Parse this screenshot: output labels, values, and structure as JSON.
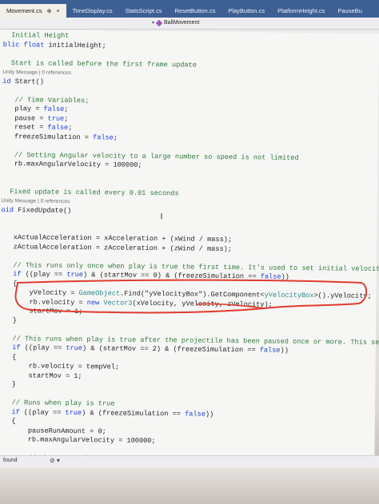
{
  "tabs": [
    {
      "label": "Movement.cs",
      "close": "×",
      "pin": "⊕",
      "active": true
    },
    {
      "label": "TimeDisplay.cs",
      "active": false
    },
    {
      "label": "StatsScript.cs",
      "active": false
    },
    {
      "label": "ResetButton.cs",
      "active": false
    },
    {
      "label": "PlayButton.cs",
      "active": false
    },
    {
      "label": "PlatformHeight.cs",
      "active": false
    },
    {
      "label": "PauseBu",
      "active": false
    }
  ],
  "nav": {
    "member": "BallMovement",
    "dropdown": "▾"
  },
  "code": [
    {
      "segments": [
        {
          "t": "  Initial Height",
          "c": "cm"
        }
      ]
    },
    {
      "segments": [
        {
          "t": "blic ",
          "c": "kw"
        },
        {
          "t": "float ",
          "c": "kw"
        },
        {
          "t": "initialHeight;"
        }
      ]
    },
    {
      "segments": [
        {
          "t": " "
        }
      ]
    },
    {
      "segments": [
        {
          "t": "  Start is called before the first frame update",
          "c": "cm"
        }
      ]
    },
    {
      "meta": "Unity Message | 0 references"
    },
    {
      "segments": [
        {
          "t": "id ",
          "c": "kw"
        },
        {
          "t": "Start()"
        }
      ]
    },
    {
      "segments": [
        {
          "t": " "
        }
      ]
    },
    {
      "segments": [
        {
          "t": "   // Time Variables;",
          "c": "cm"
        }
      ]
    },
    {
      "segments": [
        {
          "t": "   play = "
        },
        {
          "t": "false",
          "c": "kw"
        },
        {
          "t": ";"
        }
      ]
    },
    {
      "segments": [
        {
          "t": "   pause = "
        },
        {
          "t": "true",
          "c": "kw"
        },
        {
          "t": ";"
        }
      ]
    },
    {
      "segments": [
        {
          "t": "   reset = "
        },
        {
          "t": "false",
          "c": "kw"
        },
        {
          "t": ";"
        }
      ]
    },
    {
      "segments": [
        {
          "t": "   freezeSimulation = "
        },
        {
          "t": "false",
          "c": "kw"
        },
        {
          "t": ";"
        }
      ]
    },
    {
      "segments": [
        {
          "t": " "
        }
      ]
    },
    {
      "segments": [
        {
          "t": "   // Setting Angular velocity to a large number so speed is not limited",
          "c": "cm"
        }
      ]
    },
    {
      "segments": [
        {
          "t": "   rb.maxAngularVelocity = 100000;"
        }
      ]
    },
    {
      "segments": [
        {
          "t": " "
        }
      ]
    },
    {
      "segments": [
        {
          "t": " "
        }
      ]
    },
    {
      "segments": [
        {
          "t": "  Fixed update is called every 0.01 seconds",
          "c": "cm"
        }
      ]
    },
    {
      "meta": "Unity Message | 0 references"
    },
    {
      "segments": [
        {
          "t": "oid ",
          "c": "kw"
        },
        {
          "t": "FixedUpdate()"
        }
      ]
    },
    {
      "segments": [
        {
          "t": " "
        }
      ]
    },
    {
      "segments": [
        {
          "t": " "
        }
      ]
    },
    {
      "segments": [
        {
          "t": "   xActualAcceleration = xAcceleration + (xWind / mass);"
        }
      ]
    },
    {
      "segments": [
        {
          "t": "   zActualAcceleration = zAcceleration + (zWind / mass);"
        }
      ]
    },
    {
      "segments": [
        {
          "t": " "
        }
      ]
    },
    {
      "segments": [
        {
          "t": "   // This runs only once when play is true the first time. It's used to set initial velocity",
          "c": "cm"
        }
      ]
    },
    {
      "segments": [
        {
          "t": "   "
        },
        {
          "t": "if",
          "c": "kw"
        },
        {
          "t": " ((play == "
        },
        {
          "t": "true",
          "c": "kw"
        },
        {
          "t": ") & (startMov == 0) & (freezeSimulation == "
        },
        {
          "t": "false",
          "c": "kw"
        },
        {
          "t": "))"
        }
      ]
    },
    {
      "segments": [
        {
          "t": "   {"
        }
      ]
    },
    {
      "segments": [
        {
          "t": "       yVelocity = "
        },
        {
          "t": "GameObject",
          "c": "ty"
        },
        {
          "t": ".Find(\"yVelocityBox\").GetComponent<"
        },
        {
          "t": "yVelocityBox",
          "c": "ty"
        },
        {
          "t": ">().yVelocity;"
        }
      ]
    },
    {
      "segments": [
        {
          "t": "       rb.velocity = "
        },
        {
          "t": "new ",
          "c": "kw"
        },
        {
          "t": "Vector3",
          "c": "ty"
        },
        {
          "t": "(xVelocity, yVelocity, zVelocity);"
        }
      ]
    },
    {
      "segments": [
        {
          "t": "       startMov = 1;"
        }
      ]
    },
    {
      "segments": [
        {
          "t": "   }"
        }
      ]
    },
    {
      "segments": [
        {
          "t": " "
        }
      ]
    },
    {
      "segments": [
        {
          "t": "   // This runs when play is true after the projectile has been paused once or more. This sets the",
          "c": "cm"
        }
      ]
    },
    {
      "segments": [
        {
          "t": "   "
        },
        {
          "t": "if",
          "c": "kw"
        },
        {
          "t": " ((play == "
        },
        {
          "t": "true",
          "c": "kw"
        },
        {
          "t": ") & (startMov == 2) & (freezeSimulation == "
        },
        {
          "t": "false",
          "c": "kw"
        },
        {
          "t": "))"
        }
      ]
    },
    {
      "segments": [
        {
          "t": "   {"
        }
      ]
    },
    {
      "segments": [
        {
          "t": "       rb.velocity = tempVel;"
        }
      ]
    },
    {
      "segments": [
        {
          "t": "       startMov = 1;"
        }
      ]
    },
    {
      "segments": [
        {
          "t": "   }"
        }
      ]
    },
    {
      "segments": [
        {
          "t": " "
        }
      ]
    },
    {
      "segments": [
        {
          "t": "   // Runs when play is true",
          "c": "cm"
        }
      ]
    },
    {
      "segments": [
        {
          "t": "   "
        },
        {
          "t": "if",
          "c": "kw"
        },
        {
          "t": " ((play == "
        },
        {
          "t": "true",
          "c": "kw"
        },
        {
          "t": ") & (freezeSimulation == "
        },
        {
          "t": "false",
          "c": "kw"
        },
        {
          "t": "))"
        }
      ]
    },
    {
      "segments": [
        {
          "t": "   {"
        }
      ]
    },
    {
      "segments": [
        {
          "t": "       pauseRunAmount = 0;"
        }
      ]
    },
    {
      "segments": [
        {
          "t": "       rb.maxAngularVelocity = 100000;"
        }
      ]
    },
    {
      "segments": [
        {
          "t": " "
        }
      ]
    },
    {
      "segments": [
        {
          "t": "       // What controls acceleration:",
          "c": "cm"
        }
      ]
    }
  ],
  "status": {
    "found": "found",
    "control": "⊘ ▾"
  },
  "colors": {
    "tabbar": "#3d5f93",
    "keyword": "#1b3fd6",
    "comment": "#2f7a3a",
    "type": "#2b8a8a",
    "annotation": "#e23b2e"
  }
}
